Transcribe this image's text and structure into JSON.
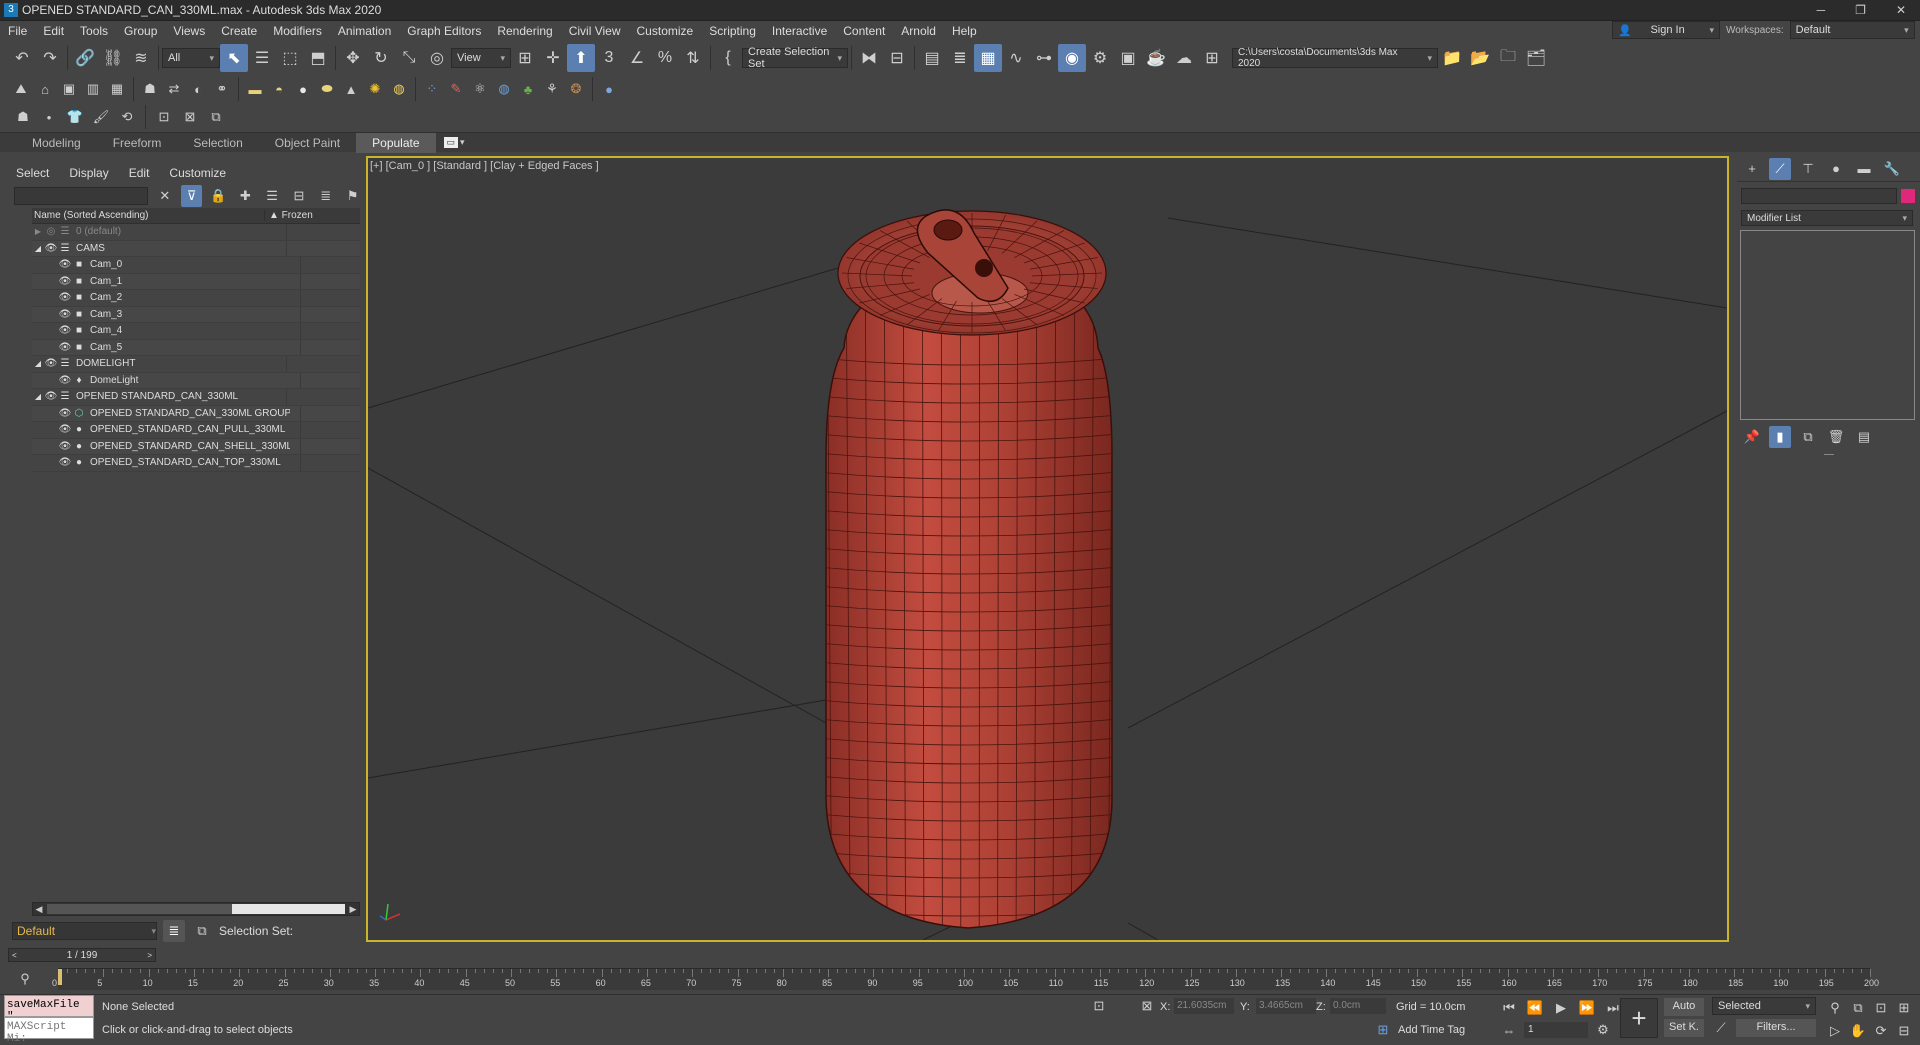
{
  "title": {
    "app_title": "OPENED STANDARD_CAN_330ML.max - Autodesk 3ds Max 2020"
  },
  "menu": [
    "File",
    "Edit",
    "Tools",
    "Group",
    "Views",
    "Create",
    "Modifiers",
    "Animation",
    "Graph Editors",
    "Rendering",
    "Civil View",
    "Customize",
    "Scripting",
    "Interactive",
    "Content",
    "Arnold",
    "Help"
  ],
  "account": {
    "sign_in": "Sign In",
    "workspaces_label": "Workspaces:",
    "workspace": "Default"
  },
  "toolbar": {
    "filter": "All",
    "view": "View",
    "selection_set": "Create Selection Set",
    "path": "C:\\Users\\costa\\Documents\\3ds Max 2020"
  },
  "ribbon_tabs": [
    "Modeling",
    "Freeform",
    "Selection",
    "Object Paint",
    "Populate"
  ],
  "scene_explorer": {
    "menu": [
      "Select",
      "Display",
      "Edit",
      "Customize"
    ],
    "col_name": "Name (Sorted Ascending)",
    "col_frozen": "▲ Frozen",
    "rows": [
      {
        "label": "0 (default)",
        "level": 0,
        "type": "layer",
        "dim": true
      },
      {
        "label": "CAMS",
        "level": 0,
        "type": "layer"
      },
      {
        "label": "Cam_0",
        "level": 1,
        "type": "camera"
      },
      {
        "label": "Cam_1",
        "level": 1,
        "type": "camera"
      },
      {
        "label": "Cam_2",
        "level": 1,
        "type": "camera"
      },
      {
        "label": "Cam_3",
        "level": 1,
        "type": "camera"
      },
      {
        "label": "Cam_4",
        "level": 1,
        "type": "camera"
      },
      {
        "label": "Cam_5",
        "level": 1,
        "type": "camera"
      },
      {
        "label": "DOMELIGHT",
        "level": 0,
        "type": "layer"
      },
      {
        "label": "DomeLight",
        "level": 1,
        "type": "light"
      },
      {
        "label": "OPENED STANDARD_CAN_330ML",
        "level": 0,
        "type": "layer"
      },
      {
        "label": "OPENED STANDARD_CAN_330ML GROUP",
        "level": 1,
        "type": "group"
      },
      {
        "label": "OPENED_STANDARD_CAN_PULL_330ML",
        "level": 1,
        "type": "mesh"
      },
      {
        "label": "OPENED_STANDARD_CAN_SHELL_330ML",
        "level": 1,
        "type": "mesh"
      },
      {
        "label": "OPENED_STANDARD_CAN_TOP_330ML",
        "level": 1,
        "type": "mesh"
      }
    ],
    "layer_default": "Default",
    "selection_set_label": "Selection Set:"
  },
  "viewport": {
    "label": "[+] [Cam_0 ] [Standard ] [Clay + Edged Faces ]"
  },
  "command_panel": {
    "modifier_list": "Modifier List"
  },
  "timeline": {
    "frame": "1 / 199",
    "ticks": [
      "0",
      "5",
      "10",
      "15",
      "20",
      "25",
      "30",
      "35",
      "40",
      "45",
      "50",
      "55",
      "60",
      "65",
      "70",
      "75",
      "80",
      "85",
      "90",
      "95",
      "100",
      "105",
      "110",
      "115",
      "120",
      "125",
      "130",
      "135",
      "140",
      "145",
      "150",
      "155",
      "160",
      "165",
      "170",
      "175",
      "180",
      "185",
      "190",
      "195",
      "200"
    ]
  },
  "status": {
    "maxscript_1": "saveMaxFile \"",
    "maxscript_2": "MAXScript Mi:",
    "selected": "None Selected",
    "prompt": "Click or click-and-drag to select objects",
    "x_label": "X:",
    "x_val": "21.6035cm",
    "y_label": "Y:",
    "y_val": "3.4665cm",
    "z_label": "Z:",
    "z_val": "0.0cm",
    "grid": "Grid = 10.0cm",
    "add_time_tag": "Add Time Tag",
    "auto": "Auto",
    "setk": "Set K.",
    "key_mode": "Selected",
    "filters": "Filters...",
    "frame_field": "1"
  },
  "colors": {
    "can": "#b8463a",
    "accent": "#5a7fb0",
    "viewport_border": "#c9b42a"
  }
}
